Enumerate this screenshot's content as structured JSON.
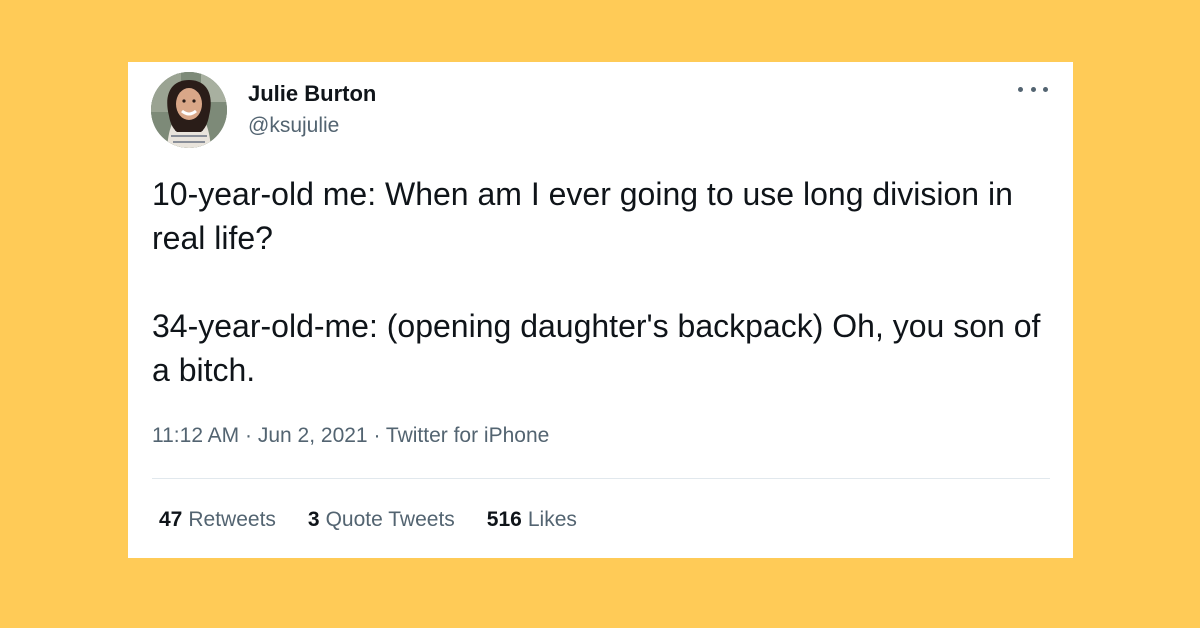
{
  "colors": {
    "background": "#FFCB57",
    "card": "#FFFFFF",
    "text_primary": "#0F1419",
    "text_secondary": "#536471"
  },
  "author": {
    "name": "Julie Burton",
    "handle": "@ksujulie",
    "avatar_icon": "profile-photo"
  },
  "tweet": {
    "paragraphs": [
      "10-year-old me: When am I ever going to use long division in real life?",
      "34-year-old-me: (opening daughter's backpack) Oh, you son of a bitch."
    ],
    "time": "11:12 AM",
    "date": "Jun 2, 2021",
    "source": "Twitter for iPhone"
  },
  "stats": {
    "retweets": {
      "count": "47",
      "label": "Retweets"
    },
    "quote_tweets": {
      "count": "3",
      "label": "Quote Tweets"
    },
    "likes": {
      "count": "516",
      "label": "Likes"
    }
  },
  "menu_icon": "more-horizontal-icon"
}
